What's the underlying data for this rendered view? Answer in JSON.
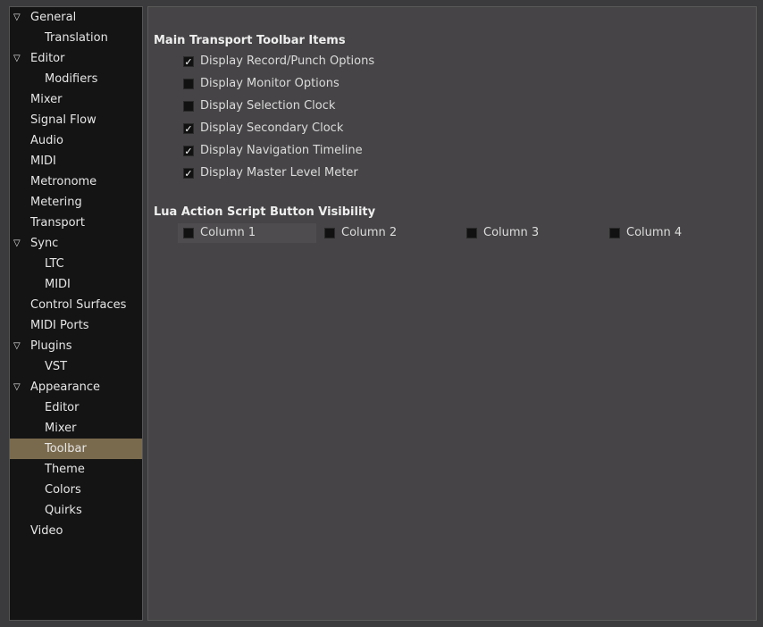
{
  "sidebar": {
    "items": [
      {
        "label": "General",
        "level": 0,
        "expanded": true
      },
      {
        "label": "Translation",
        "level": 1
      },
      {
        "label": "Editor",
        "level": 0,
        "expanded": true
      },
      {
        "label": "Modifiers",
        "level": 1
      },
      {
        "label": "Mixer",
        "level": 0
      },
      {
        "label": "Signal Flow",
        "level": 0
      },
      {
        "label": "Audio",
        "level": 0
      },
      {
        "label": "MIDI",
        "level": 0
      },
      {
        "label": "Metronome",
        "level": 0
      },
      {
        "label": "Metering",
        "level": 0
      },
      {
        "label": "Transport",
        "level": 0
      },
      {
        "label": "Sync",
        "level": 0,
        "expanded": true
      },
      {
        "label": "LTC",
        "level": 1
      },
      {
        "label": "MIDI",
        "level": 1
      },
      {
        "label": "Control Surfaces",
        "level": 0
      },
      {
        "label": "MIDI Ports",
        "level": 0
      },
      {
        "label": "Plugins",
        "level": 0,
        "expanded": true
      },
      {
        "label": "VST",
        "level": 1
      },
      {
        "label": "Appearance",
        "level": 0,
        "expanded": true
      },
      {
        "label": "Editor",
        "level": 1
      },
      {
        "label": "Mixer",
        "level": 1
      },
      {
        "label": "Toolbar",
        "level": 1,
        "selected": true
      },
      {
        "label": "Theme",
        "level": 1
      },
      {
        "label": "Colors",
        "level": 1
      },
      {
        "label": "Quirks",
        "level": 1
      },
      {
        "label": "Video",
        "level": 0
      }
    ]
  },
  "main": {
    "transport_section": {
      "title": "Main Transport Toolbar Items",
      "options": [
        {
          "label": "Display Record/Punch Options",
          "checked": true
        },
        {
          "label": "Display Monitor Options",
          "checked": false
        },
        {
          "label": "Display Selection Clock",
          "checked": false
        },
        {
          "label": "Display Secondary Clock",
          "checked": true
        },
        {
          "label": "Display Navigation Timeline",
          "checked": true
        },
        {
          "label": "Display Master Level Meter",
          "checked": true
        }
      ]
    },
    "lua_section": {
      "title": "Lua Action Script Button Visibility",
      "columns": [
        {
          "label": "Column 1",
          "checked": false
        },
        {
          "label": "Column 2",
          "checked": false
        },
        {
          "label": "Column 3",
          "checked": false
        },
        {
          "label": "Column 4",
          "checked": false
        }
      ]
    }
  },
  "colors": {
    "selection": "#7a6a4d",
    "sidebar_bg": "#141414",
    "content_bg": "#464446"
  },
  "icons": {
    "expander": "triangle-down-icon",
    "check": "checkmark-icon"
  }
}
